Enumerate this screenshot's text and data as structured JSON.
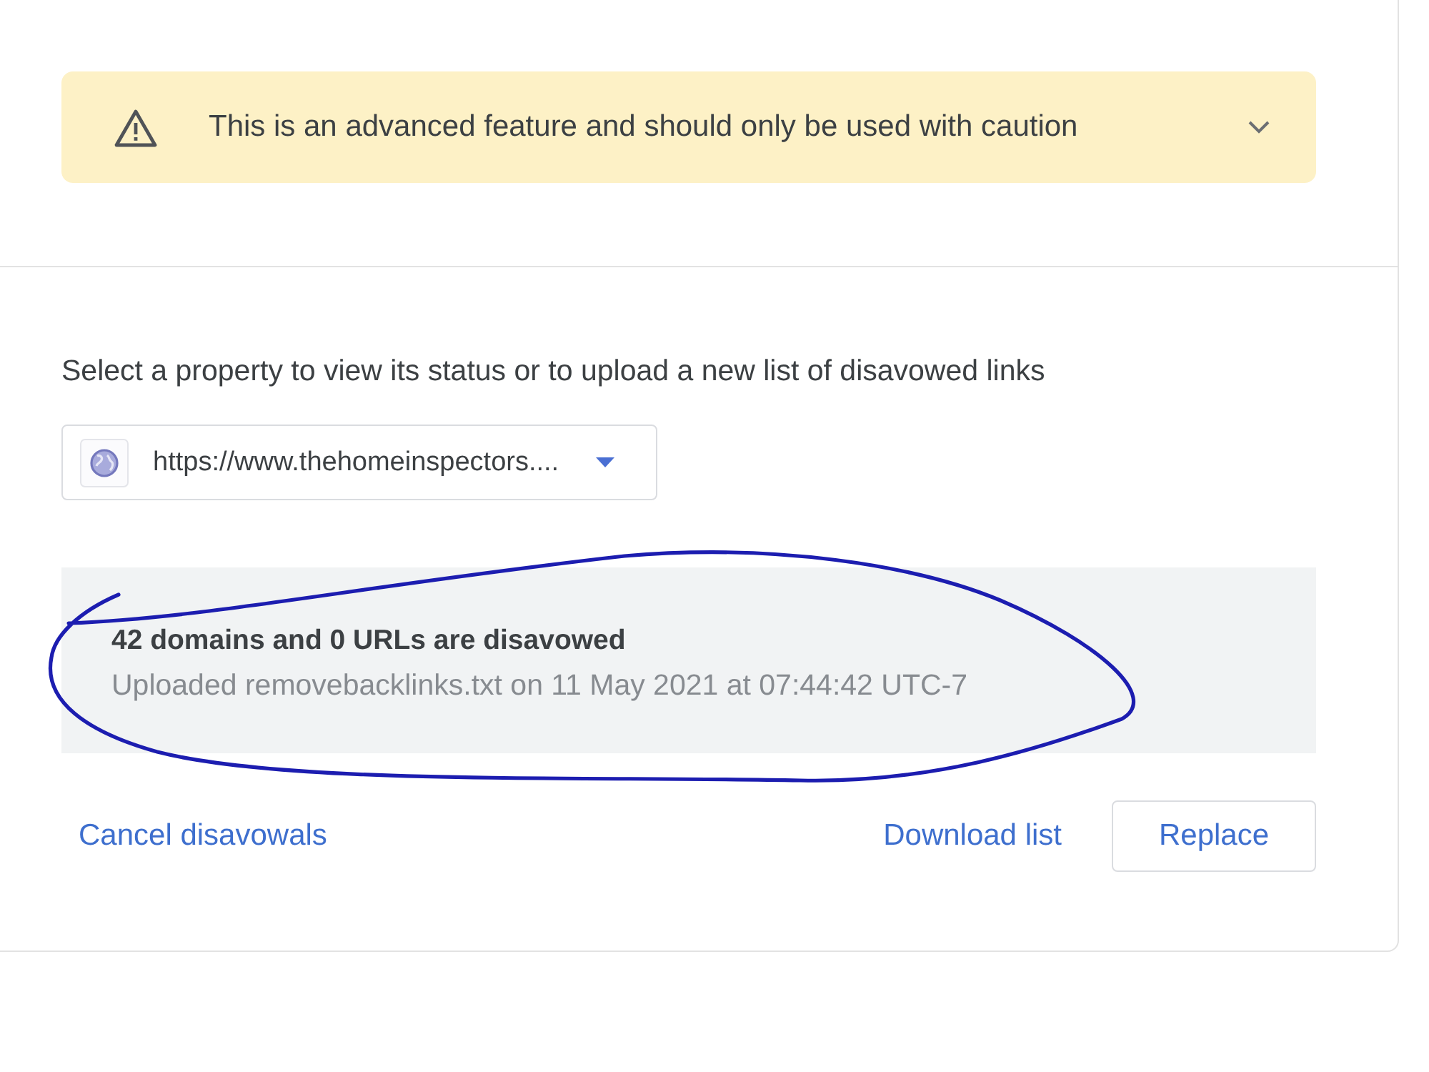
{
  "warning_banner": {
    "text": "This is an advanced feature and should only be used with caution",
    "expanded": false
  },
  "property_selector": {
    "label": "Select a property to view its status or to upload a new list of disavowed links",
    "value": "https://www.thehomeinspectors...."
  },
  "status": {
    "title": "42 domains and 0 URLs are disavowed",
    "detail": "Uploaded removebacklinks.txt on 11 May 2021 at 07:44:42 UTC-7"
  },
  "actions_left": [
    {
      "label": "Cancel disavowals",
      "kind": "link"
    }
  ],
  "actions_right": [
    {
      "label": "Download list",
      "kind": "link"
    },
    {
      "label": "Replace",
      "kind": "outlined"
    }
  ]
}
